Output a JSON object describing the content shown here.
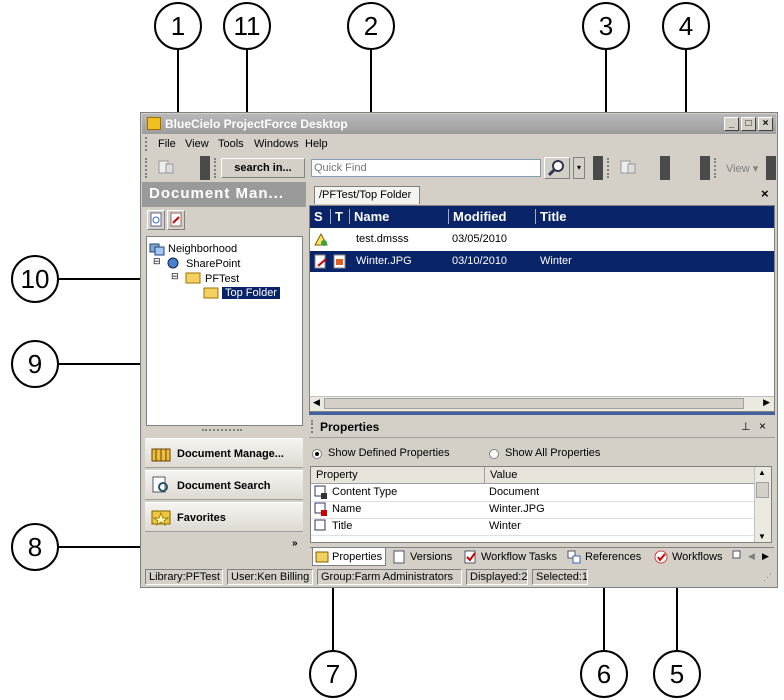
{
  "callouts": [
    "1",
    "11",
    "2",
    "3",
    "4",
    "9",
    "10",
    "8",
    "7",
    "6",
    "5"
  ],
  "window": {
    "title": "BlueCielo ProjectForce Desktop"
  },
  "menu": [
    "File",
    "View",
    "Tools",
    "Windows",
    "Help"
  ],
  "toolbar": {
    "search_label": "search in...",
    "quick_find_placeholder": "Quick Find",
    "view_label": "View"
  },
  "left": {
    "header": "Document Man...",
    "tree": [
      "Neighborhood",
      "SharePoint",
      "PFTest",
      "Top Folder"
    ],
    "nav": [
      "Document Manage...",
      "Document Search",
      "Favorites"
    ]
  },
  "doc_tab": "/PFTest/Top Folder",
  "grid": {
    "columns": [
      "S",
      "T",
      "Name",
      "Modified",
      "Title"
    ],
    "rows": [
      {
        "name": "test.dmsss",
        "modified": "03/05/2010",
        "title": ""
      },
      {
        "name": "Winter.JPG",
        "modified": "03/10/2010",
        "title": "Winter"
      }
    ]
  },
  "properties": {
    "title": "Properties",
    "radio_defined": "Show Defined Properties",
    "radio_all": "Show All Properties",
    "col_property": "Property",
    "col_value": "Value",
    "rows": [
      {
        "property": "Content Type",
        "value": "Document"
      },
      {
        "property": "Name",
        "value": "Winter.JPG"
      },
      {
        "property": "Title",
        "value": "Winter"
      }
    ],
    "tabs": [
      "Properties",
      "Versions",
      "Workflow Tasks",
      "References",
      "Workflows"
    ]
  },
  "status": [
    "Library:PFTest",
    "User:Ken Billing",
    "Group:Farm  Administrators",
    "Displayed:2",
    "Selected:1"
  ],
  "colors": {
    "selection": "#0a246a",
    "grid_header": "#0a246a",
    "title_bar": "#a8a8a8"
  }
}
